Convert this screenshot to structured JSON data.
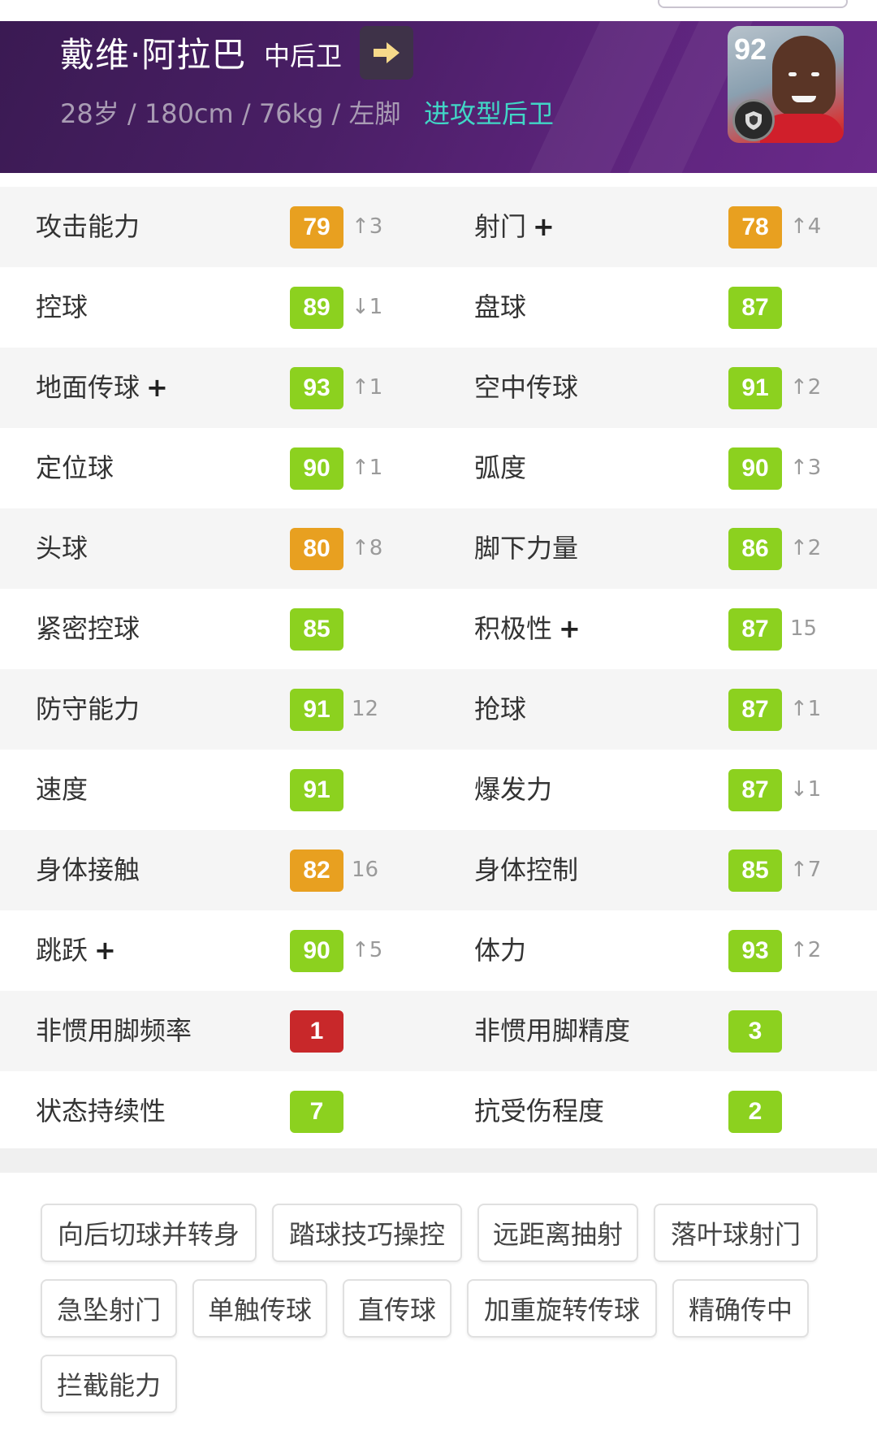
{
  "player": {
    "name": "戴维·阿拉巴",
    "position": "中后卫",
    "meta": "28岁 / 180cm / 76kg / 左脚",
    "style": "进攻型后卫",
    "rating": "92"
  },
  "colors": {
    "green": "#8cd11f",
    "orange": "#e8a020",
    "red": "#c8282a",
    "header": "#4a1f66",
    "style_text": "#41d6c6"
  },
  "stats": [
    {
      "left": {
        "label": "攻击能力",
        "plus": false,
        "value": "79",
        "color": "orange",
        "delta": "↑3"
      },
      "right": {
        "label": "射门",
        "plus": true,
        "value": "78",
        "color": "orange",
        "delta": "↑4"
      }
    },
    {
      "left": {
        "label": "控球",
        "plus": false,
        "value": "89",
        "color": "green",
        "delta": "↓1"
      },
      "right": {
        "label": "盘球",
        "plus": false,
        "value": "87",
        "color": "green",
        "delta": ""
      }
    },
    {
      "left": {
        "label": "地面传球",
        "plus": true,
        "value": "93",
        "color": "green",
        "delta": "↑1"
      },
      "right": {
        "label": "空中传球",
        "plus": false,
        "value": "91",
        "color": "green",
        "delta": "↑2"
      }
    },
    {
      "left": {
        "label": "定位球",
        "plus": false,
        "value": "90",
        "color": "green",
        "delta": "↑1"
      },
      "right": {
        "label": "弧度",
        "plus": false,
        "value": "90",
        "color": "green",
        "delta": "↑3"
      }
    },
    {
      "left": {
        "label": "头球",
        "plus": false,
        "value": "80",
        "color": "orange",
        "delta": "↑8"
      },
      "right": {
        "label": "脚下力量",
        "plus": false,
        "value": "86",
        "color": "green",
        "delta": "↑2"
      }
    },
    {
      "left": {
        "label": "紧密控球",
        "plus": false,
        "value": "85",
        "color": "green",
        "delta": ""
      },
      "right": {
        "label": "积极性",
        "plus": true,
        "value": "87",
        "color": "green",
        "delta": "15"
      }
    },
    {
      "left": {
        "label": "防守能力",
        "plus": false,
        "value": "91",
        "color": "green",
        "delta": "12"
      },
      "right": {
        "label": "抢球",
        "plus": false,
        "value": "87",
        "color": "green",
        "delta": "↑1"
      }
    },
    {
      "left": {
        "label": "速度",
        "plus": false,
        "value": "91",
        "color": "green",
        "delta": ""
      },
      "right": {
        "label": "爆发力",
        "plus": false,
        "value": "87",
        "color": "green",
        "delta": "↓1"
      }
    },
    {
      "left": {
        "label": "身体接触",
        "plus": false,
        "value": "82",
        "color": "orange",
        "delta": "16"
      },
      "right": {
        "label": "身体控制",
        "plus": false,
        "value": "85",
        "color": "green",
        "delta": "↑7"
      }
    },
    {
      "left": {
        "label": "跳跃",
        "plus": true,
        "value": "90",
        "color": "green",
        "delta": "↑5"
      },
      "right": {
        "label": "体力",
        "plus": false,
        "value": "93",
        "color": "green",
        "delta": "↑2"
      }
    },
    {
      "left": {
        "label": "非惯用脚频率",
        "plus": false,
        "value": "1",
        "color": "red",
        "delta": ""
      },
      "right": {
        "label": "非惯用脚精度",
        "plus": false,
        "value": "3",
        "color": "green",
        "delta": ""
      }
    },
    {
      "left": {
        "label": "状态持续性",
        "plus": false,
        "value": "7",
        "color": "green",
        "delta": ""
      },
      "right": {
        "label": "抗受伤程度",
        "plus": false,
        "value": "2",
        "color": "green",
        "delta": ""
      }
    }
  ],
  "skills": [
    "向后切球并转身",
    "踏球技巧操控",
    "远距离抽射",
    "落叶球射门",
    "急坠射门",
    "单触传球",
    "直传球",
    "加重旋转传球",
    "精确传中",
    "拦截能力"
  ],
  "icons": {
    "arrow": "arrow-right-icon",
    "club": "club-badge-icon"
  }
}
